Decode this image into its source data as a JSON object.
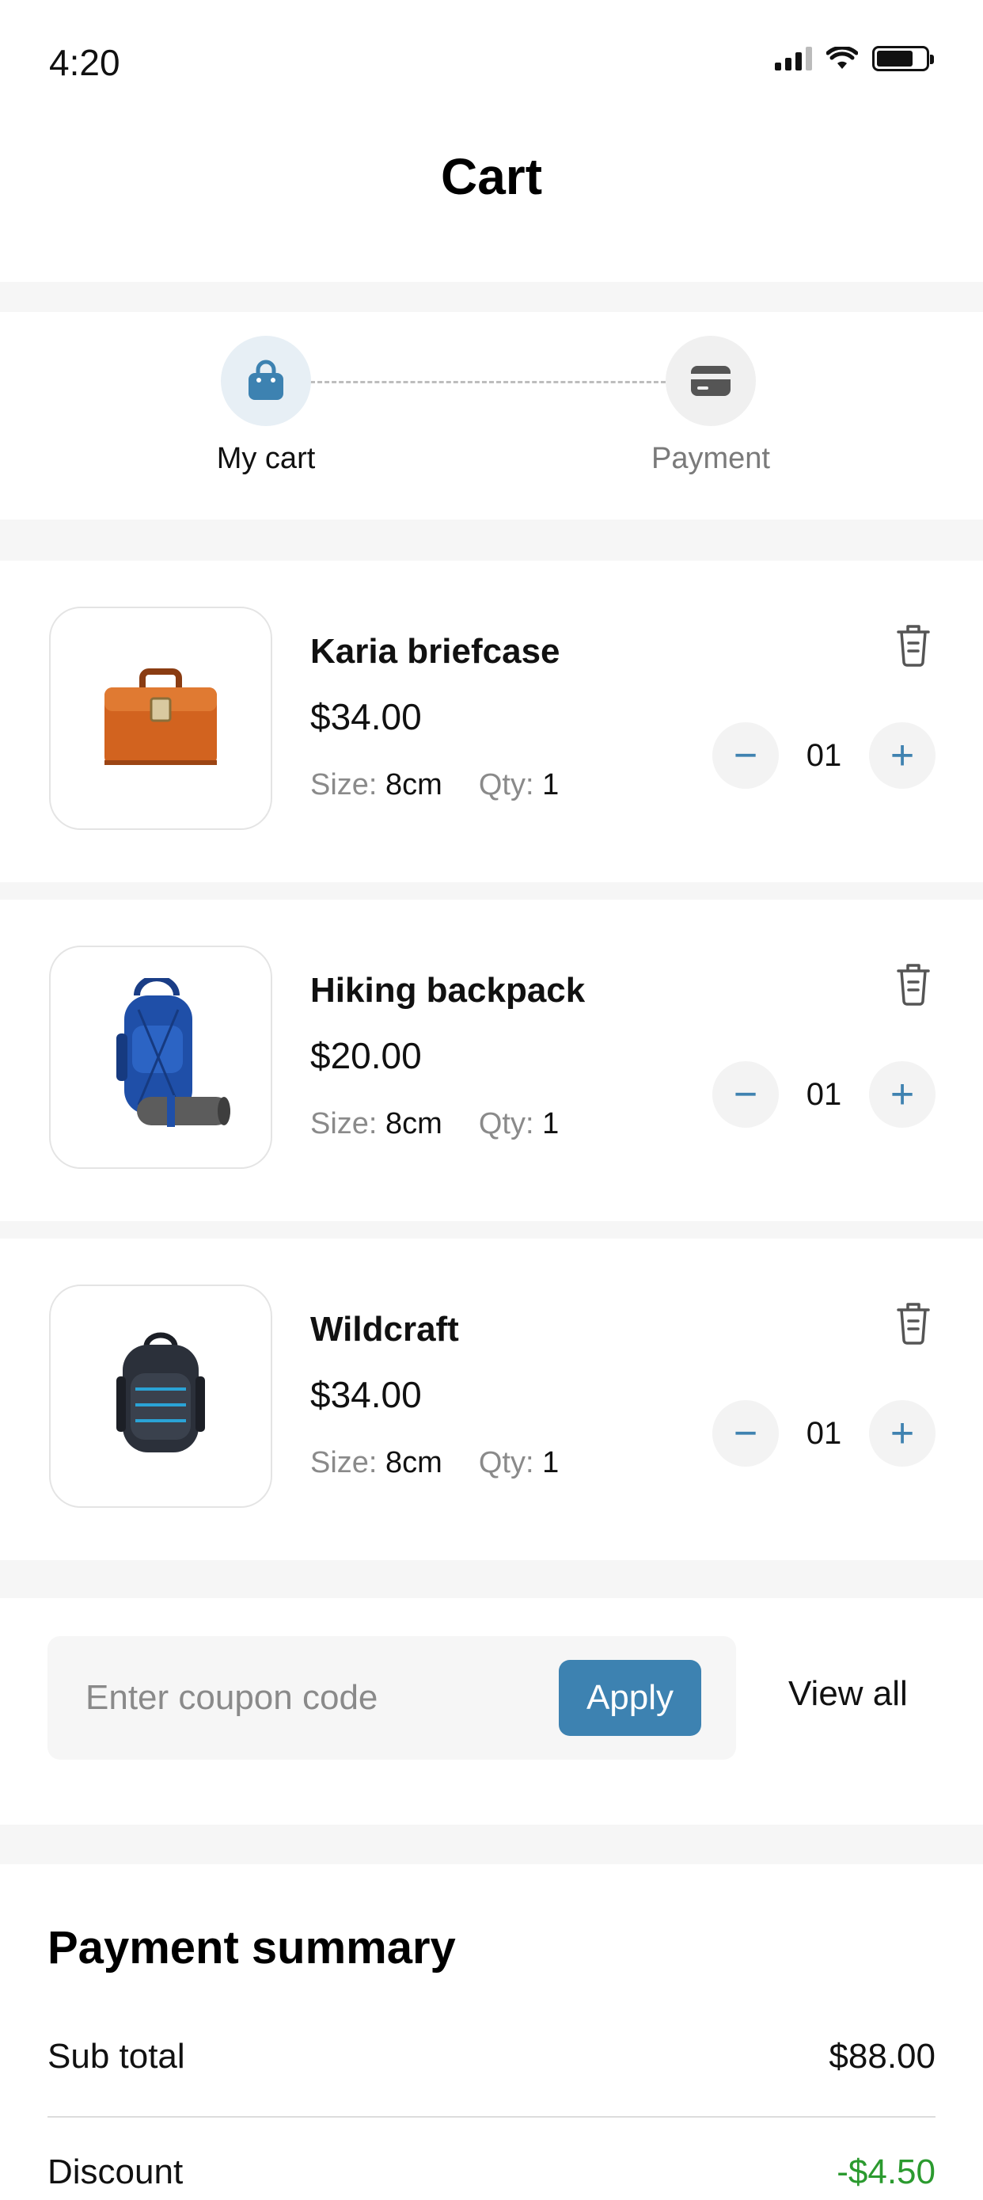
{
  "status_bar": {
    "time": "4:20"
  },
  "header": {
    "title": "Cart"
  },
  "stepper": {
    "steps": [
      {
        "label": "My cart",
        "icon": "shopping-bag-icon"
      },
      {
        "label": "Payment",
        "icon": "credit-card-icon"
      }
    ]
  },
  "cart": {
    "items": [
      {
        "name": "Karia briefcase",
        "price": "$34.00",
        "size_label": "Size:",
        "size": "8cm",
        "qty_label": "Qty:",
        "qty": "1",
        "stepper_qty": "01",
        "image": "briefcase"
      },
      {
        "name": "Hiking backpack",
        "price": "$20.00",
        "size_label": "Size:",
        "size": "8cm",
        "qty_label": "Qty:",
        "qty": "1",
        "stepper_qty": "01",
        "image": "hiking-backpack"
      },
      {
        "name": "Wildcraft",
        "price": "$34.00",
        "size_label": "Size:",
        "size": "8cm",
        "qty_label": "Qty:",
        "qty": "1",
        "stepper_qty": "01",
        "image": "laptop-backpack"
      }
    ],
    "minus_symbol": "−",
    "plus_symbol": "+"
  },
  "coupon": {
    "placeholder": "Enter coupon code",
    "apply_label": "Apply",
    "view_all_label": "View all"
  },
  "summary": {
    "title": "Payment summary",
    "rows": [
      {
        "label": "Sub total",
        "value": "$88.00"
      },
      {
        "label": "Discount",
        "value": "-$4.50"
      }
    ]
  },
  "colors": {
    "accent": "#3d82b1",
    "discount": "#2b9a2f",
    "briefcase": "#d2631f",
    "backpack_blue": "#1f4fa8"
  }
}
